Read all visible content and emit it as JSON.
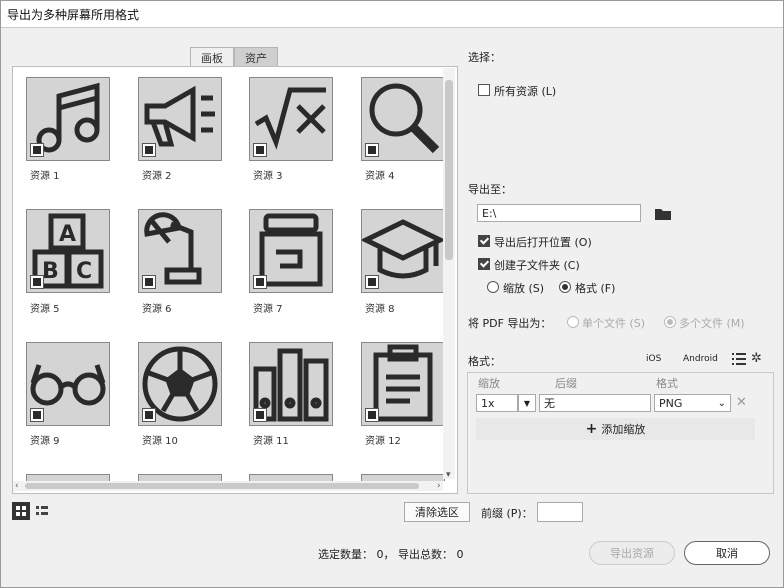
{
  "window": {
    "title": "导出为多种屏幕所用格式"
  },
  "tabs": [
    {
      "label": "画板",
      "active": false
    },
    {
      "label": "资产",
      "active": true
    }
  ],
  "assets": [
    {
      "label": "资源 1",
      "icon": "music-note-icon"
    },
    {
      "label": "资源 2",
      "icon": "megaphone-icon"
    },
    {
      "label": "资源 3",
      "icon": "math-symbols-icon"
    },
    {
      "label": "资源 4",
      "icon": "magnifier-icon"
    },
    {
      "label": "资源 5",
      "icon": "abc-blocks-icon"
    },
    {
      "label": "资源 6",
      "icon": "desk-lamp-icon"
    },
    {
      "label": "资源 7",
      "icon": "jar-icon"
    },
    {
      "label": "资源 8",
      "icon": "graduation-cap-icon"
    },
    {
      "label": "资源 9",
      "icon": "glasses-icon"
    },
    {
      "label": "资源 10",
      "icon": "soccer-ball-icon"
    },
    {
      "label": "资源 11",
      "icon": "binders-icon"
    },
    {
      "label": "资源 12",
      "icon": "clipboard-icon"
    }
  ],
  "select": {
    "heading": "选择：",
    "all_assets": "所有资源 (L)",
    "all_checked": false
  },
  "export_to": {
    "heading": "导出至：",
    "path": "E:\\",
    "open_after": "导出后打开位置 (O)",
    "open_after_checked": true,
    "create_subfolder": "创建子文件夹 (C)",
    "create_subfolder_checked": true,
    "radio_scale": "缩放 (S)",
    "radio_format": "格式 (F)",
    "selected": "format"
  },
  "pdf": {
    "label": "将 PDF 导出为：",
    "single": "单个文件 (S)",
    "multiple": "多个文件 (M)",
    "selected": "multiple"
  },
  "format": {
    "heading": "格式：",
    "ios": "iOS",
    "android": "Android",
    "col_scale": "缩放",
    "col_suffix": "后缀",
    "col_format": "格式",
    "row": {
      "scale": "1x",
      "suffix": "无",
      "format": "PNG"
    },
    "add_scale": "添加缩放"
  },
  "bottom": {
    "clear_selection": "清除选区",
    "prefix_label": "前缀 (P)：",
    "prefix_value": "",
    "status": "选定数量： 0， 导出总数： 0",
    "export_button": "导出资源",
    "cancel_button": "取消"
  },
  "colors": {
    "tile_bg": "#d4d4d4",
    "icon_stroke": "#2a2a2a"
  }
}
